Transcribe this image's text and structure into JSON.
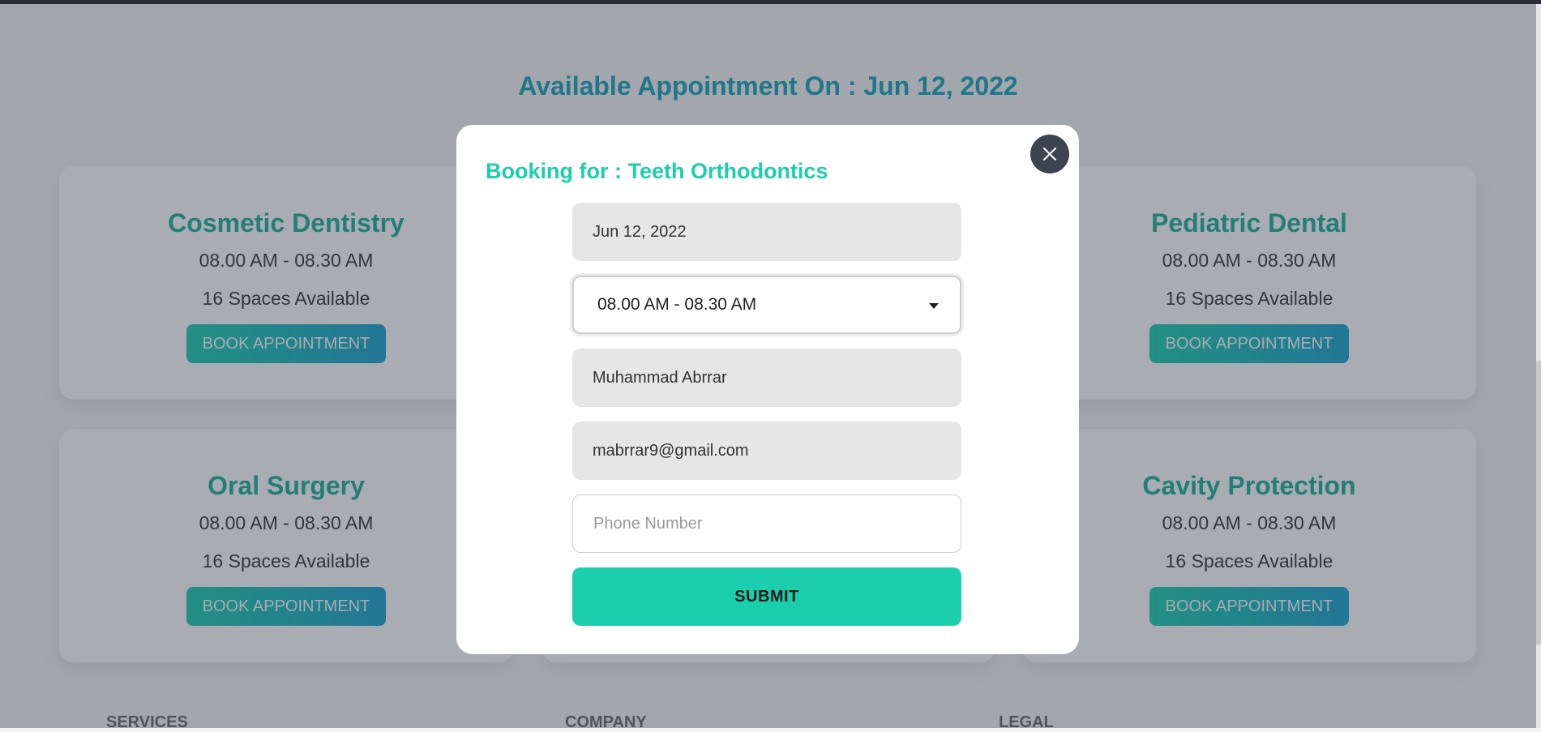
{
  "headline": "Available Appointment On : Jun 12, 2022",
  "cards": [
    {
      "title": "Cosmetic Dentistry",
      "time": "08.00 AM - 08.30 AM",
      "spaces": "16 Spaces Available",
      "button": "BOOK APPOINTMENT"
    },
    {
      "title": "Pediatric Dental",
      "time": "08.00 AM - 08.30 AM",
      "spaces": "16 Spaces Available",
      "button": "BOOK APPOINTMENT"
    },
    {
      "title": "Oral Surgery",
      "time": "08.00 AM - 08.30 AM",
      "spaces": "16 Spaces Available",
      "button": "BOOK APPOINTMENT"
    },
    {
      "title": "Cavity Protection",
      "time": "08.00 AM - 08.30 AM",
      "spaces": "16 Spaces Available",
      "button": "BOOK APPOINTMENT"
    }
  ],
  "footer": {
    "col1": "SERVICES",
    "col2": "COMPANY",
    "col3": "LEGAL"
  },
  "modal": {
    "title": "Booking for : Teeth Orthodontics",
    "close_icon": "close-icon",
    "date_value": "Jun 12, 2022",
    "slot_value": "08.00 AM - 08.30 AM",
    "name_value": "Muhammad Abrrar",
    "email_value": "mabrrar9@gmail.com",
    "phone_placeholder": "Phone Number",
    "submit_label": "SUBMIT"
  },
  "colors": {
    "accent": "#1ccfac",
    "headline": "#19a7b8",
    "card_title": "#20b39a"
  }
}
